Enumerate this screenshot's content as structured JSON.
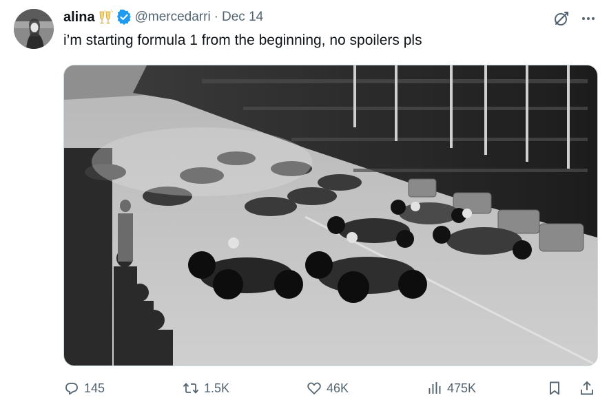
{
  "tweet": {
    "display_name": "alina",
    "name_emoji": "clinking-glasses-emoji",
    "verified": true,
    "handle": "@mercedarri",
    "separator": "·",
    "date": "Dec 14",
    "text": "i’m starting formula 1 from the beginning, no spoilers pls",
    "media_description_icon": "vintage-race-start-photo"
  },
  "actions": {
    "replies": "145",
    "reposts": "1.5K",
    "likes": "46K",
    "views": "475K"
  },
  "colors": {
    "text": "#0f1419",
    "secondary": "#536471",
    "verified_blue": "#1d9bf0",
    "border": "#cfd9de"
  }
}
